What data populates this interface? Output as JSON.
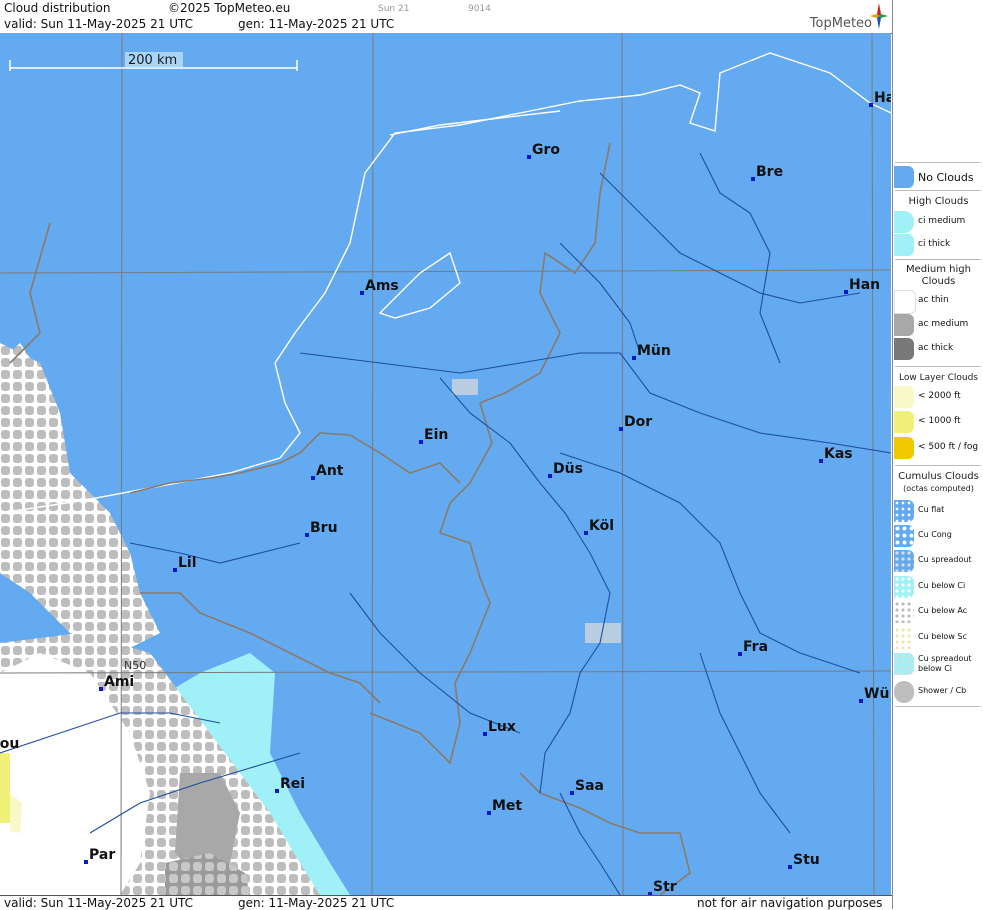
{
  "header": {
    "title": "Cloud distribution",
    "copyright": "©2025 TopMeteo.eu",
    "small_day": "Sun 21",
    "small_code": "9014",
    "valid": "valid:  Sun  11-May-2025  21 UTC",
    "gen": "gen: 11-May-2025 21 UTC",
    "logo": "TopMeteo"
  },
  "footer": {
    "valid": "valid:  Sun  11-May-2025  21 UTC",
    "gen": "gen: 11-May-2025 21 UTC",
    "note": "not for air navigation purposes"
  },
  "map": {
    "scale_label": "200 km",
    "grid_label": "N50",
    "cities": [
      {
        "name": "Gro"
      },
      {
        "name": "Bre"
      },
      {
        "name": "Ha"
      },
      {
        "name": "Ams"
      },
      {
        "name": "Han"
      },
      {
        "name": "Mün"
      },
      {
        "name": "Dor"
      },
      {
        "name": "Ein"
      },
      {
        "name": "Ant"
      },
      {
        "name": "Düs"
      },
      {
        "name": "Kas"
      },
      {
        "name": "Bru"
      },
      {
        "name": "Köl"
      },
      {
        "name": "Lil"
      },
      {
        "name": "Fra"
      },
      {
        "name": "Ami"
      },
      {
        "name": "Wü"
      },
      {
        "name": "Lux"
      },
      {
        "name": "Rei"
      },
      {
        "name": "Saa"
      },
      {
        "name": "Met"
      },
      {
        "name": "Par"
      },
      {
        "name": "Stu"
      },
      {
        "name": "Str"
      },
      {
        "name": "Rou"
      }
    ]
  },
  "legend": {
    "no_clouds": "No Clouds",
    "high_head": "High Clouds",
    "ci_medium": "ci medium",
    "ci_thick": "ci thick",
    "mid_head_1": "Medium high",
    "mid_head_2": "Clouds",
    "ac_thin": "ac thin",
    "ac_medium": "ac medium",
    "ac_thick": "ac thick",
    "low_head": "Low Layer Clouds",
    "low_2000": "< 2000 ft",
    "low_1000": "< 1000 ft",
    "low_500": "< 500 ft / fog",
    "cu_head_1": "Cumulus Clouds",
    "cu_head_2": "(octas computed)",
    "cu_flat": "Cu flat",
    "cu_cong": "Cu Cong",
    "cu_spread": "Cu spreadout",
    "cu_below_ci": "Cu below Ci",
    "cu_below_ac": "Cu below Ac",
    "cu_below_sc": "Cu below Sc",
    "cu_spread_ci_1": "Cu spreadout",
    "cu_spread_ci_2": "below Ci",
    "shower": "Shower / Cb",
    "colors": {
      "no_clouds": "#64aaf0",
      "ci": "#a0f0f8",
      "ac_medium": "#a8a8a8",
      "ac_thick": "#787878",
      "low_2000": "#f8f8c8",
      "low_1000": "#f0f078",
      "low_500": "#f0c800"
    }
  }
}
